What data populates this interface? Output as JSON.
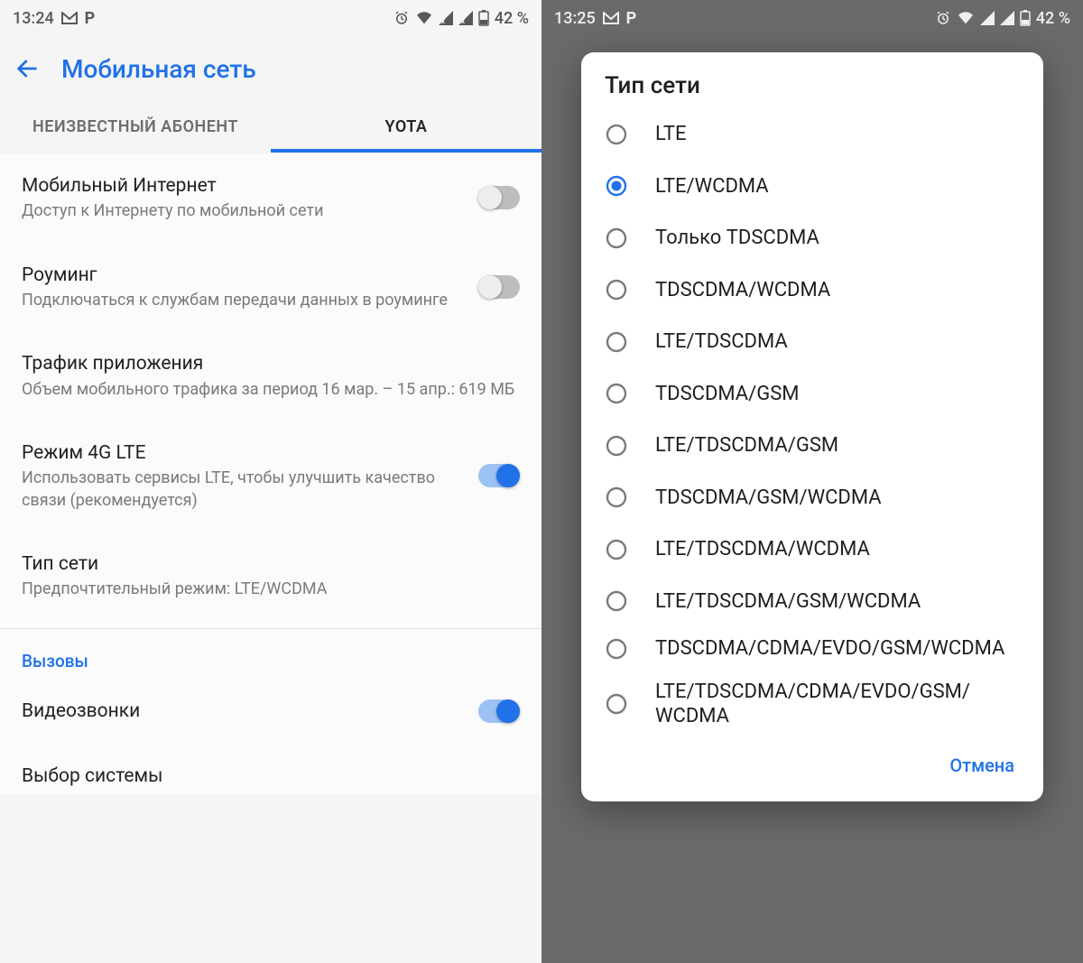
{
  "left": {
    "status": {
      "time": "13:24",
      "battery": "42 %"
    },
    "title": "Мобильная сеть",
    "tabs": {
      "a": "НЕИЗВЕСТНЫЙ АБОНЕНТ",
      "b": "YOTA"
    },
    "items": {
      "mobile_data": {
        "title": "Мобильный Интернет",
        "sub": "Доступ к Интернету по мобильной сети"
      },
      "roaming": {
        "title": "Роуминг",
        "sub": "Подключаться к службам передачи данных в роуминге"
      },
      "app_traffic": {
        "title": "Трафик приложения",
        "sub": "Объем мобильного трафика за период 16 мар. – 15 апр.: 619 МБ"
      },
      "lte_mode": {
        "title": "Режим 4G LTE",
        "sub": "Использовать сервисы LTE, чтобы улучшить качество связи (рекомендуется)"
      },
      "net_type": {
        "title": "Тип сети",
        "sub": "Предпочтительный режим: LTE/WCDMA"
      },
      "calls_section": "Вызовы",
      "video_calls": {
        "title": "Видеозвонки"
      },
      "system_select": {
        "title": "Выбор системы"
      }
    }
  },
  "right": {
    "status": {
      "time": "13:25",
      "battery": "42 %"
    },
    "dialog": {
      "title": "Тип сети",
      "options": [
        "LTE",
        "LTE/WCDMA",
        "Только TDSCDMA",
        "TDSCDMA/WCDMA",
        "LTE/TDSCDMA",
        "TDSCDMA/GSM",
        "LTE/TDSCDMA/GSM",
        "TDSCDMA/GSM/WCDMA",
        "LTE/TDSCDMA/WCDMA",
        "LTE/TDSCDMA/GSM/WCDMA",
        "TDSCDMA/CDMA/EVDO/GSM/WCDMA",
        "LTE/TDSCDMA/CDMA/EVDO/GSM/WCDMA"
      ],
      "selected_index": 1,
      "cancel": "Отмена"
    }
  }
}
